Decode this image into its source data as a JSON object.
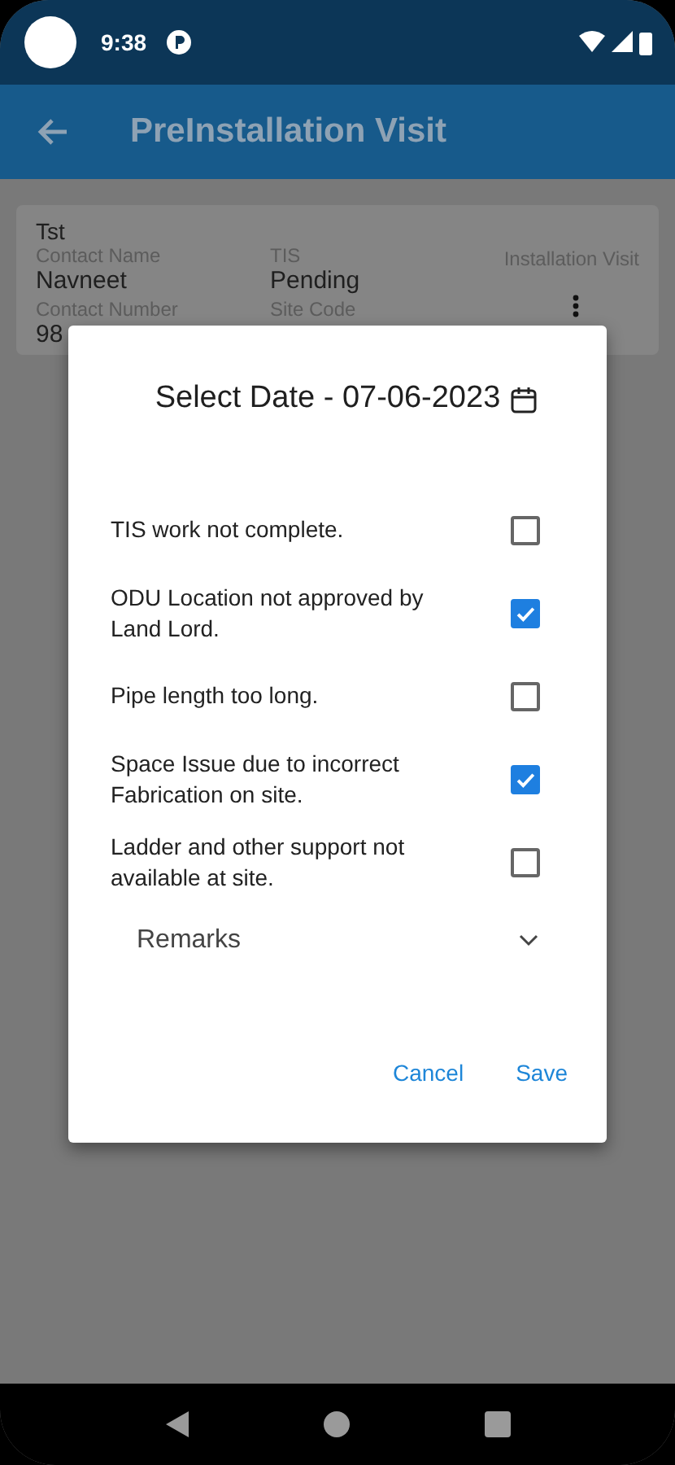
{
  "status_bar": {
    "time": "9:38"
  },
  "app_bar": {
    "title": "PreInstallation Visit"
  },
  "card": {
    "name": "Tst",
    "fields": [
      {
        "label": "Contact Name",
        "value": "Navneet"
      },
      {
        "label": "TIS",
        "value": "Pending"
      },
      {
        "label": "Contact Number",
        "value": "98"
      },
      {
        "label": "Site Code"
      }
    ],
    "action_label": "Installation Visit"
  },
  "dialog": {
    "title": "Select Date - 07-06-2023",
    "reasons": [
      {
        "label": "TIS work not complete.",
        "checked": false
      },
      {
        "label": "ODU Location not approved by Land Lord.",
        "checked": true
      },
      {
        "label": "Pipe length too long.",
        "checked": false
      },
      {
        "label": "Space Issue due to incorrect Fabrication on site.",
        "checked": true
      },
      {
        "label": "Ladder and other support not available at site.",
        "checked": false
      }
    ],
    "remarks": {
      "label": "Remarks",
      "expanded": false
    },
    "buttons": [
      {
        "label": "Cancel"
      },
      {
        "label": "Save"
      }
    ]
  }
}
